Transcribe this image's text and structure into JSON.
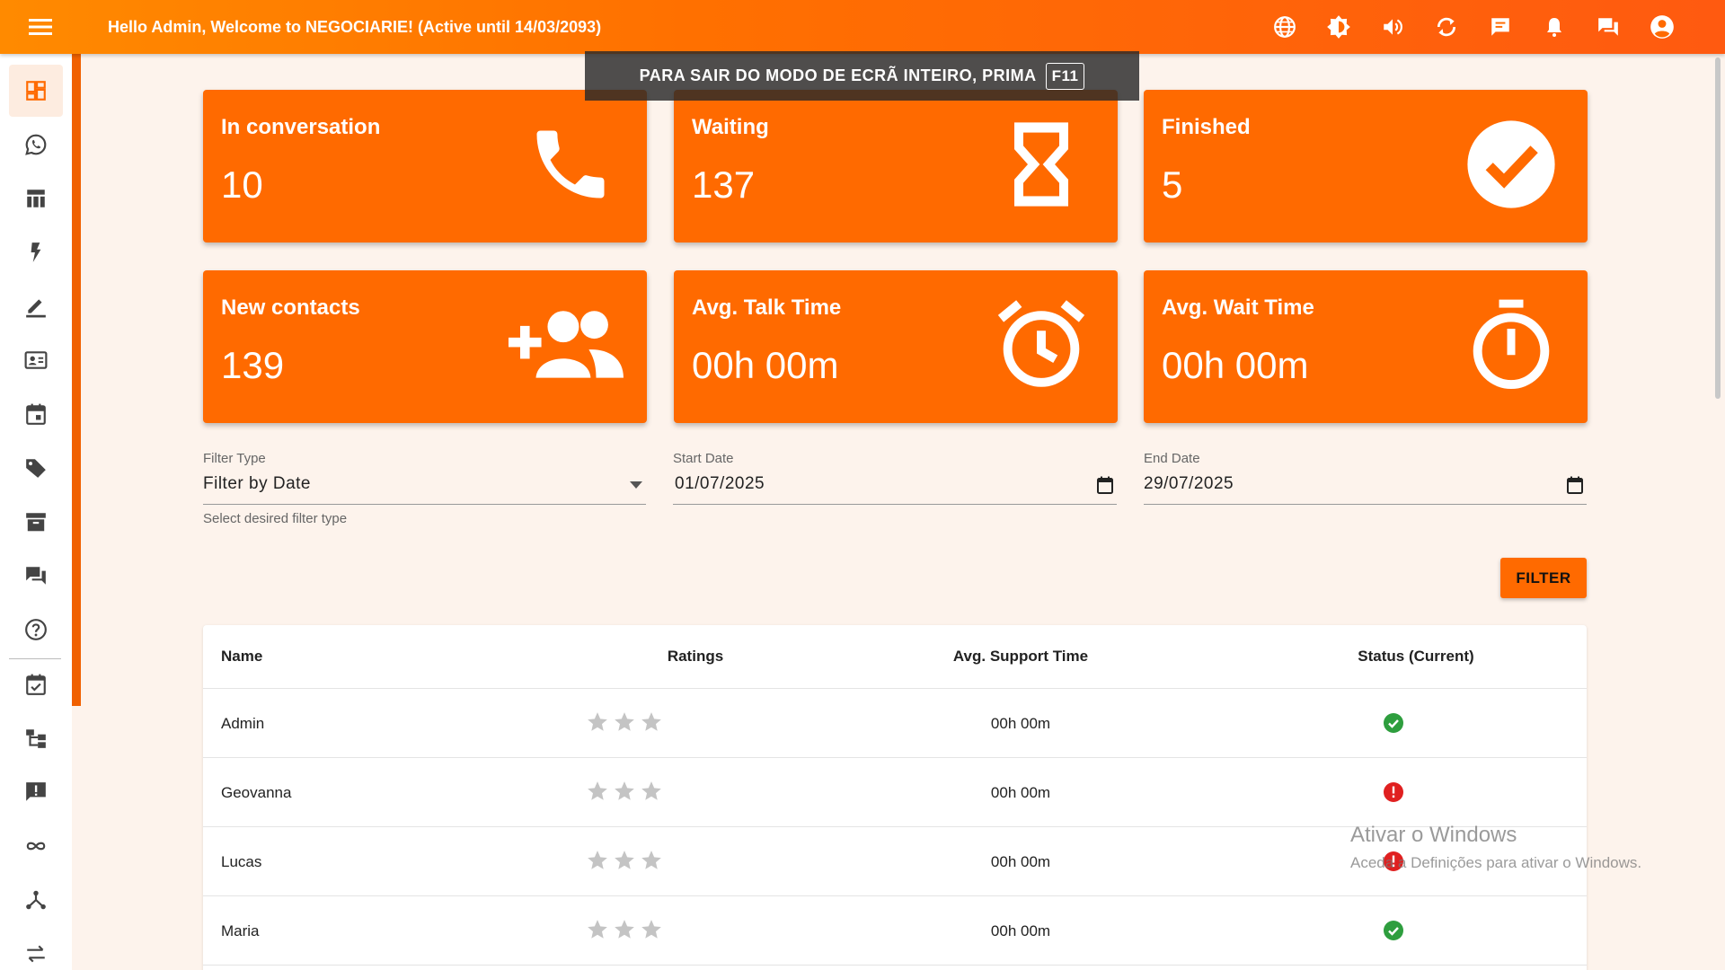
{
  "header": {
    "greeting": "Hello Admin, Welcome to NEGOCIARIE! (Active until 14/03/2093)",
    "icons": [
      "globe-icon",
      "brightness-icon",
      "volume-icon",
      "sync-icon",
      "chat-icon",
      "bell-icon",
      "forum-icon",
      "account-icon"
    ]
  },
  "fullscreen_notice": {
    "text": "PARA SAIR DO MODO DE ECRÃ INTEIRO, PRIMA",
    "key": "F11"
  },
  "sidebar": {
    "items": [
      "dashboard-icon",
      "whatsapp-icon",
      "table-icon",
      "flash-icon",
      "edit-icon",
      "contacts-icon",
      "calendar-icon",
      "tag-icon",
      "archive-icon",
      "forum-icon",
      "help-icon",
      "task-icon",
      "hierarchy-icon",
      "alert-icon",
      "infinity-icon",
      "network-icon",
      "swap-icon"
    ]
  },
  "cards": [
    {
      "title": "In conversation",
      "value": "10",
      "icon": "phone-icon"
    },
    {
      "title": "Waiting",
      "value": "137",
      "icon": "hourglass-icon"
    },
    {
      "title": "Finished",
      "value": "5",
      "icon": "check-circle-icon"
    },
    {
      "title": "New contacts",
      "value": "139",
      "icon": "add-group-icon"
    },
    {
      "title": "Avg. Talk Time",
      "value": "00h 00m",
      "icon": "alarm-icon"
    },
    {
      "title": "Avg. Wait Time",
      "value": "00h 00m",
      "icon": "timer-icon"
    }
  ],
  "filters": {
    "type_label": "Filter Type",
    "type_value": "Filter by Date",
    "type_helper": "Select desired filter type",
    "start_label": "Start Date",
    "start_value": "01/07/2025",
    "end_label": "End Date",
    "end_value": "29/07/2025",
    "button": "FILTER"
  },
  "table": {
    "headers": {
      "name": "Name",
      "ratings": "Ratings",
      "avg": "Avg. Support Time",
      "status": "Status (Current)"
    },
    "rows": [
      {
        "name": "Admin",
        "avg": "00h 00m",
        "status": "online",
        "stars": 0
      },
      {
        "name": "Geovanna",
        "avg": "00h 00m",
        "status": "offline",
        "stars": 0
      },
      {
        "name": "Lucas",
        "avg": "00h 00m",
        "status": "offline",
        "stars": 0
      },
      {
        "name": "Maria",
        "avg": "00h 00m",
        "status": "online",
        "stars": 0
      }
    ]
  },
  "watermark": {
    "title": "Ativar o Windows",
    "subtitle": "Aceda a Definições para ativar o Windows."
  },
  "colors": {
    "primary": "#ff6a00",
    "online": "#2e9e3e",
    "offline": "#e02020"
  }
}
